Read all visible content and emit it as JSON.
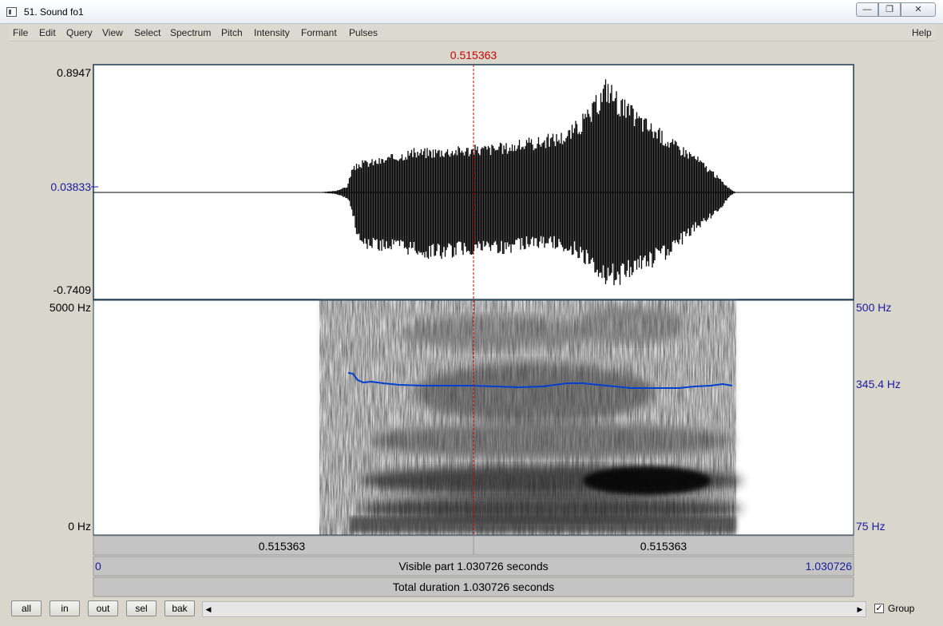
{
  "window": {
    "title": "51. Sound fo1",
    "min_symbol": "—",
    "max_symbol": "❐",
    "close_symbol": "✕"
  },
  "menu": {
    "items": [
      "File",
      "Edit",
      "Query",
      "View",
      "Select",
      "Spectrum",
      "Pitch",
      "Intensity",
      "Formant",
      "Pulses"
    ],
    "help": "Help"
  },
  "editor": {
    "cursor_time_top": "0.515363",
    "waveform": {
      "ymax": "0.8947",
      "ymid": "0.03833",
      "ymin": "-0.7409"
    },
    "spectrogram": {
      "freq_max": "5000 Hz",
      "freq_min": "0 Hz",
      "pitch_max": "500 Hz",
      "pitch_current": "345.4 Hz",
      "pitch_min": "75 Hz"
    },
    "bars": {
      "left_segment": "0.515363",
      "right_segment": "0.515363",
      "visible_start": "0",
      "visible_label": "Visible part 1.030726 seconds",
      "visible_end": "1.030726",
      "total_label": "Total duration 1.030726 seconds"
    },
    "colors": {
      "cursor": "#cc0000",
      "pitch_curve": "#0040d0",
      "axis_blue": "#1a1aa0"
    }
  },
  "toolbar": {
    "all": "all",
    "in": "in",
    "out": "out",
    "sel": "sel",
    "bak": "bak",
    "scroll_left": "◀",
    "scroll_right": "▶",
    "group_checked": "✓",
    "group_label": "Group"
  }
}
